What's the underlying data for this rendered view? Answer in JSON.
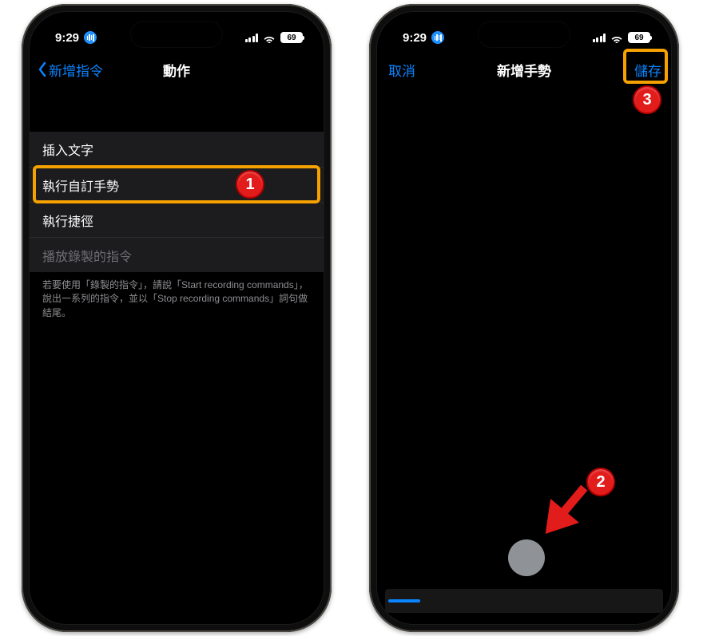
{
  "status": {
    "time": "9:29",
    "battery": "69"
  },
  "left_phone": {
    "nav_back": "新增指令",
    "nav_title": "動作",
    "rows": {
      "insert_text": "插入文字",
      "custom_gesture": "執行自訂手勢",
      "run_shortcut": "執行捷徑",
      "play_recorded": "播放錄製的指令"
    },
    "footer": "若要使用「錄製的指令」，請說「Start recording commands」，說出一系列的指令，並以「Stop recording commands」詞句做結尾。"
  },
  "right_phone": {
    "nav_cancel": "取消",
    "nav_title": "新增手勢",
    "nav_save": "儲存"
  },
  "badges": {
    "one": "1",
    "two": "2",
    "three": "3"
  }
}
